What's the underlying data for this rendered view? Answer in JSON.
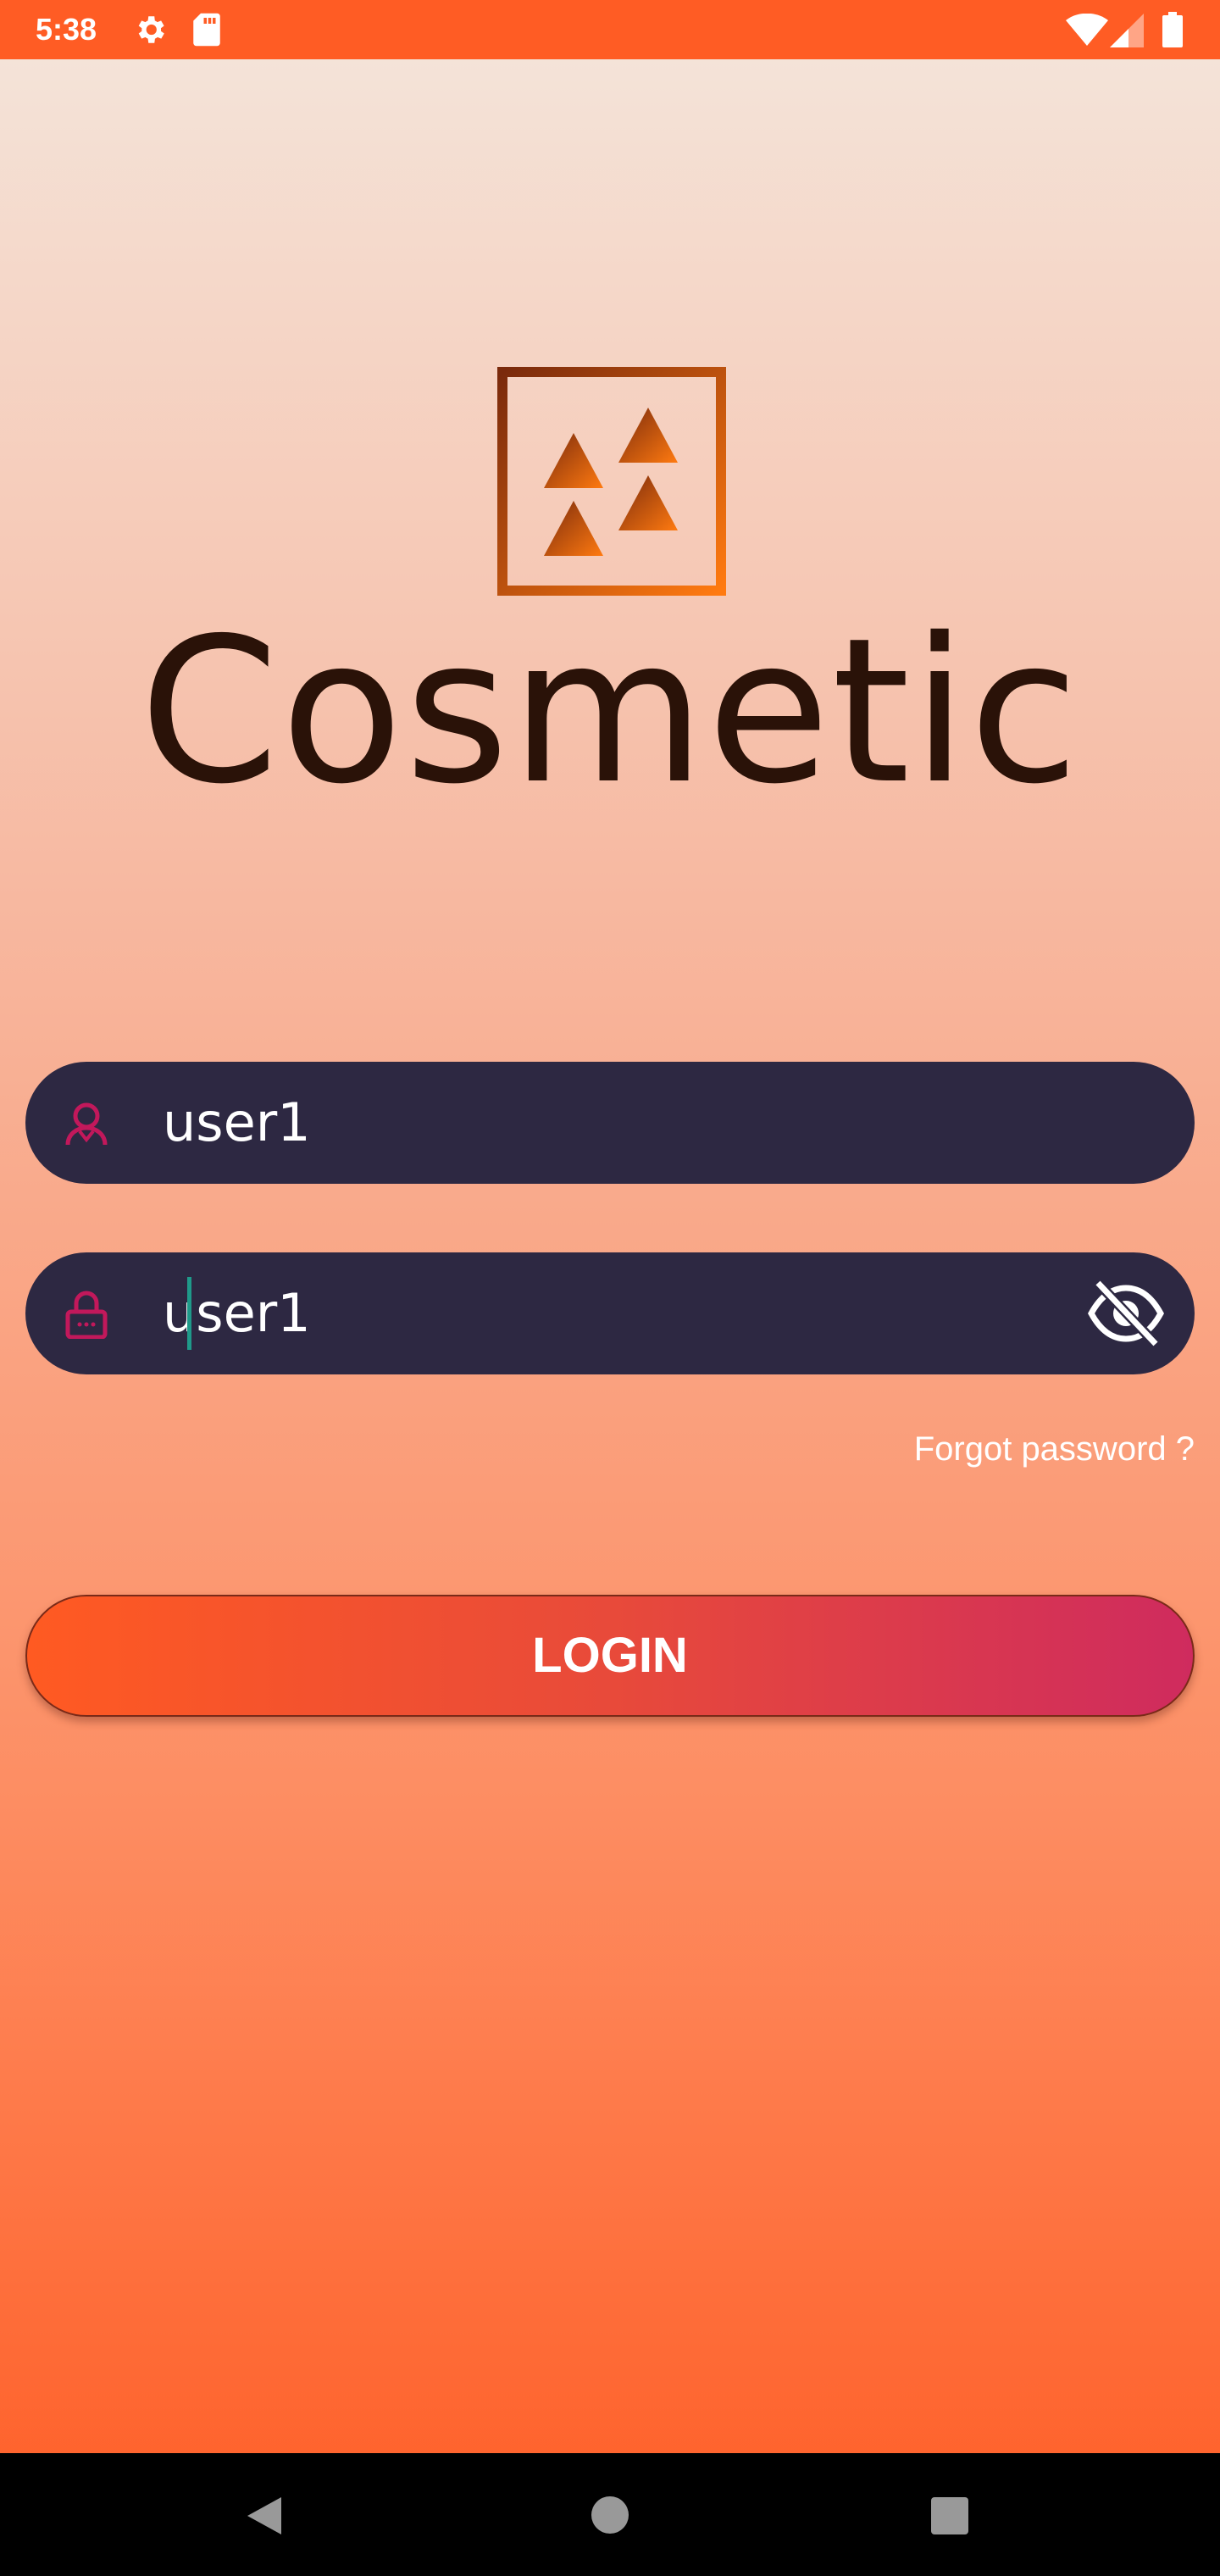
{
  "status_bar": {
    "time": "5:38",
    "icons": [
      "settings-icon",
      "sd-card-icon",
      "wifi-icon",
      "signal-icon",
      "battery-icon"
    ]
  },
  "brand": {
    "name": "Cosmetic",
    "logo": "triangles-logo",
    "text_color": "#2a1208"
  },
  "login_form": {
    "username": {
      "value": "user1",
      "icon": "person-icon"
    },
    "password": {
      "value": "user1",
      "icon": "lock-icon",
      "toggle_icon": "eye-off-icon"
    },
    "forgot_password_label": "Forgot password ?",
    "login_label": "LOGIN"
  },
  "colors": {
    "accent": "#ff5c24",
    "field_background": "#2d2842",
    "icon_pink": "#c2185b"
  },
  "nav_bar": {
    "icons": [
      "back-icon",
      "home-icon",
      "recents-icon"
    ]
  }
}
